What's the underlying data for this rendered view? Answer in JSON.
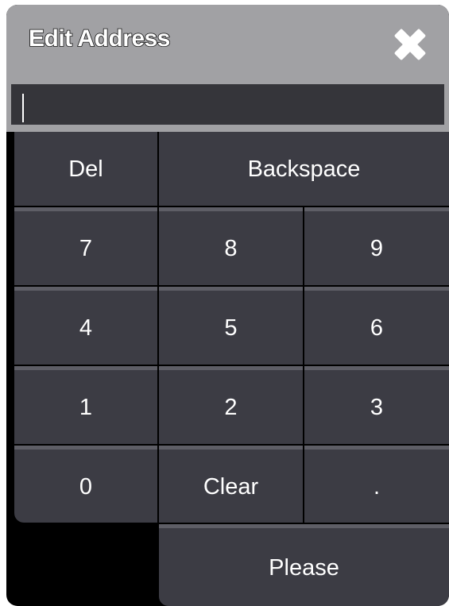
{
  "dialog": {
    "title": "Edit Address",
    "close_icon": "close-x-icon"
  },
  "input": {
    "value": ""
  },
  "keypad": {
    "row1": [
      "Del",
      "Backspace"
    ],
    "row2": [
      "7",
      "8",
      "9"
    ],
    "row3": [
      "4",
      "5",
      "6"
    ],
    "row4": [
      "1",
      "2",
      "3"
    ],
    "row5": [
      "0",
      "Clear",
      "."
    ],
    "row6": [
      "Please"
    ]
  },
  "colors": {
    "titlebar": "#a1a1a4",
    "key": "#3c3c44",
    "key_top_border": "#5e5e66",
    "background": "#000000",
    "text": "#ffffff"
  }
}
